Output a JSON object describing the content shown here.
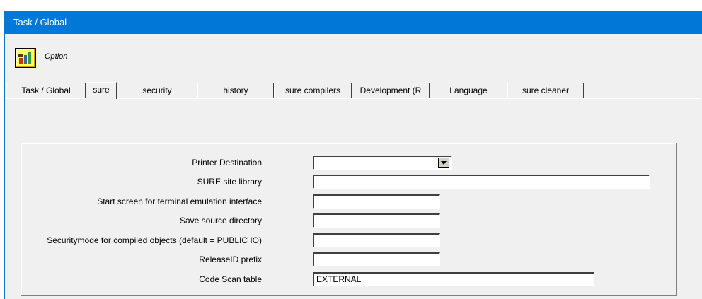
{
  "window": {
    "title": "Task / Global"
  },
  "toolbar": {
    "option_label": "Option",
    "icon": "option-tools-icon"
  },
  "tabs": [
    {
      "label": "Task / Global",
      "active": false
    },
    {
      "label": "sure",
      "active": true
    },
    {
      "label": "security",
      "active": false
    },
    {
      "label": "history",
      "active": false
    },
    {
      "label": "sure compilers",
      "active": false
    },
    {
      "label": "Development (R",
      "active": false
    },
    {
      "label": "Language",
      "active": false
    },
    {
      "label": "sure cleaner",
      "active": false
    }
  ],
  "form": {
    "printer_destination": {
      "label": "Printer Destination",
      "value": ""
    },
    "sure_site_library": {
      "label": "SURE site library",
      "value": ""
    },
    "start_screen": {
      "label": "Start screen for terminal emulation interface",
      "value": ""
    },
    "save_source_directory": {
      "label": "Save source directory",
      "value": ""
    },
    "securitymode": {
      "label": "Securitymode for compiled objects (default = PUBLIC IO)",
      "value": ""
    },
    "releaseid_prefix": {
      "label": "ReleaseID prefix",
      "value": ""
    },
    "code_scan_table": {
      "label": "Code Scan table",
      "value": "EXTERNAL"
    }
  },
  "colors": {
    "titlebar": "#0078d7",
    "window_bg": "#f0f0f0",
    "icon_bg": "#ffff66"
  }
}
